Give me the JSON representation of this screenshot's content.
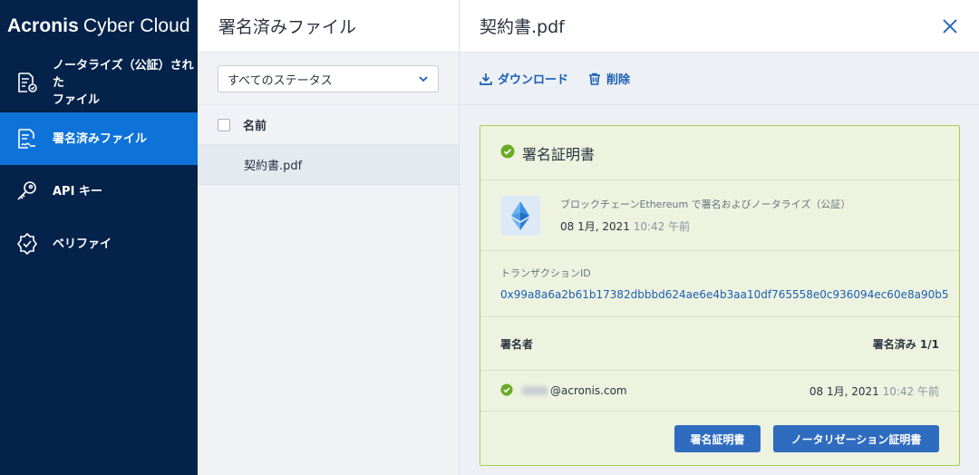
{
  "brand": {
    "name_bold": "Acronis",
    "name_rest": "Cyber Cloud"
  },
  "sidebar": {
    "items": [
      {
        "label": "ノータライズ（公証）された\nファイル",
        "icon": "notarized-file-icon"
      },
      {
        "label": "署名済みファイル",
        "icon": "signed-file-icon",
        "active": true
      },
      {
        "label": "API キー",
        "icon": "key-icon"
      },
      {
        "label": "ベリファイ",
        "icon": "verify-badge-icon"
      }
    ]
  },
  "list_panel": {
    "title": "署名済みファイル",
    "filter": {
      "selected": "すべてのステータス"
    },
    "columns": [
      "名前"
    ],
    "rows": [
      {
        "name": "契約書.pdf"
      }
    ]
  },
  "detail": {
    "title": "契約書.pdf",
    "toolbar": {
      "download": "ダウンロード",
      "delete": "削除"
    },
    "certificate": {
      "title": "署名証明書",
      "chain_text": "ブロックチェーンEthereum で署名およびノータライズ（公証）",
      "chain_date": "08 1月, 2021",
      "chain_time": "10:42 午前",
      "tx_label": "トランザクションID",
      "tx_id": "0x99a8a6a2b61b17382dbbbd624ae6e4b3aa10df765558e0c936094ec60e8a90b5",
      "signer_header": "署名者",
      "signed_count": "署名済み 1/1",
      "signer_email": "@acronis.com",
      "signer_date": "08 1月, 2021",
      "signer_time": "10:42 午前",
      "btn_signature_cert": "署名証明書",
      "btn_notarization_cert": "ノータリゼーション証明書"
    }
  },
  "colors": {
    "sidebar_bg": "#04224a",
    "active_nav": "#0e73d8",
    "accent": "#1a5fb4",
    "success": "#6aab26",
    "card_border": "#a9cc4c"
  }
}
